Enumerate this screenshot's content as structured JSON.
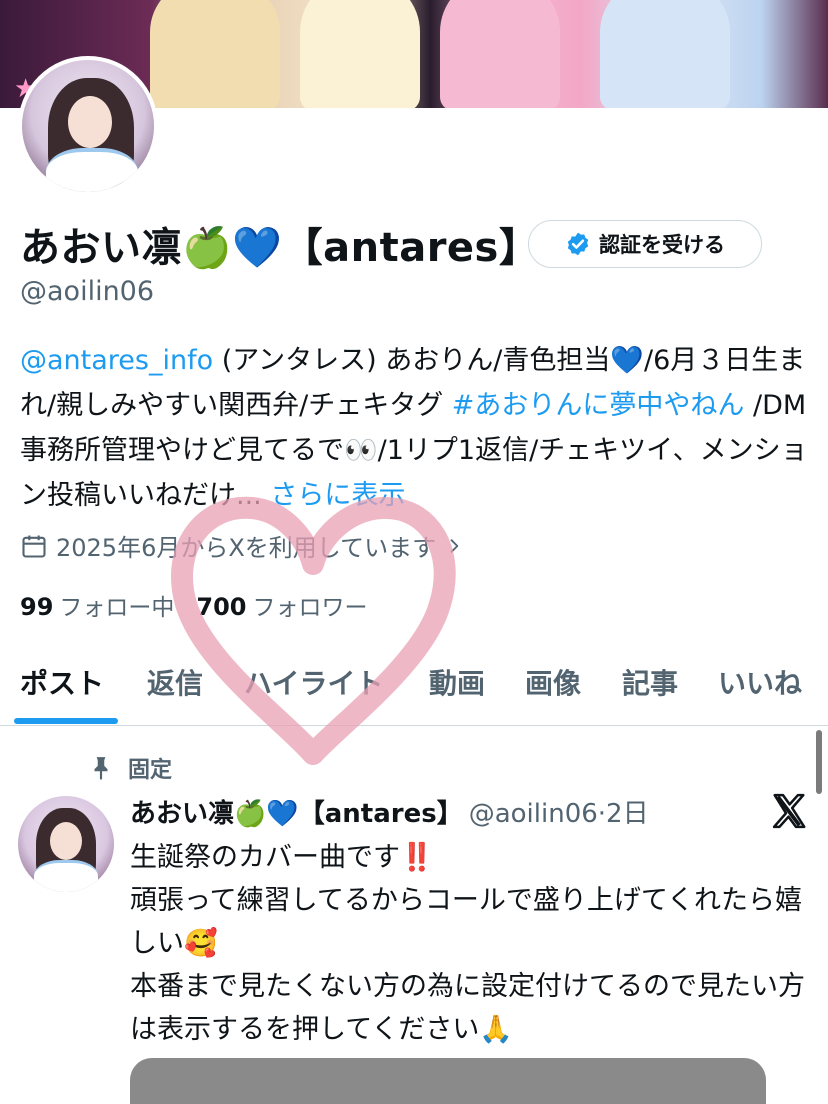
{
  "profile": {
    "display_name": "あおい凛🍏💙【antares】",
    "handle": "@aoilin06",
    "verify_label": "認証を受ける"
  },
  "bio": {
    "mention": "@antares_info",
    "text1": " (アンタレス) あおりん/青色担当💙/6月３日生まれ/親しみやすい関西弁/チェキタグ ",
    "hashtag": "#あおりんに夢中やねん",
    "text2": " /DM事務所管理やけど見てるで👀/1リプ1返信/チェキツイ、メンション投稿いいねだけ... ",
    "more": "さらに表示"
  },
  "joined": {
    "text": "2025年6月からXを利用しています"
  },
  "stats": {
    "following_count": "99",
    "following_label": "フォロー中",
    "followers_count": "700",
    "followers_label": "フォロワー"
  },
  "tabs": [
    "ポスト",
    "返信",
    "ハイライト",
    "動画",
    "画像",
    "記事",
    "いいね"
  ],
  "post": {
    "pinned_label": "固定",
    "author_name": "あおい凛🍏💙【antares】",
    "author_meta": "@aoilin06·2日",
    "lines": [
      "生誕祭のカバー曲です‼️",
      "頑張って練習してるからコールで盛り上げてくれたら嬉しい🥰",
      "本番まで見たくない方の為に設定付けてるので見たい方は表示するを押してください🙏"
    ]
  },
  "colors": {
    "accent": "#1d9bf0",
    "text_primary": "#0f1419",
    "text_secondary": "#536471",
    "heart_overlay": "#e8a0b4"
  }
}
